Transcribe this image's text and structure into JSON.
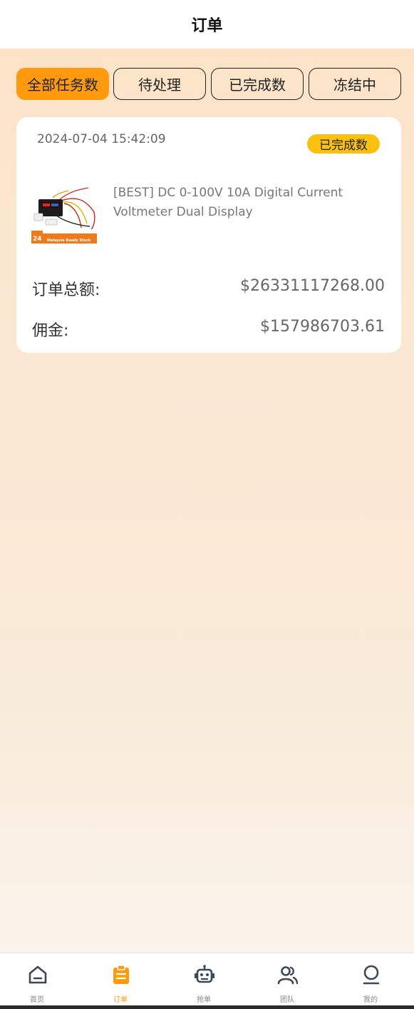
{
  "header": {
    "title": "订单"
  },
  "tabs": [
    {
      "label": "全部任务数",
      "active": true
    },
    {
      "label": "待处理",
      "active": false
    },
    {
      "label": "已完成数",
      "active": false
    },
    {
      "label": "冻结中",
      "active": false
    }
  ],
  "order": {
    "date": "2024-07-04 15:42:09",
    "status": "已完成数",
    "product_name": "[BEST] DC 0-100V 10A Digital Current Voltmeter Dual Display",
    "image_badge_number": "24",
    "image_banner_text": "Malaysia Ready Stock",
    "total_label": "订单总额:",
    "total_value": "$26331117268.00",
    "commission_label": "佣金:",
    "commission_value": "$157986703.61"
  },
  "bottom_nav": [
    {
      "label": "首页",
      "icon": "home-icon",
      "active": false
    },
    {
      "label": "订单",
      "icon": "clipboard-icon",
      "active": true
    },
    {
      "label": "抢单",
      "icon": "robot-icon",
      "active": false
    },
    {
      "label": "团队",
      "icon": "team-icon",
      "active": false
    },
    {
      "label": "我的",
      "icon": "profile-icon",
      "active": false
    }
  ],
  "colors": {
    "accent": "#ff9a0f",
    "badge": "#fcc10f",
    "inactive_icon": "#3d4756"
  }
}
